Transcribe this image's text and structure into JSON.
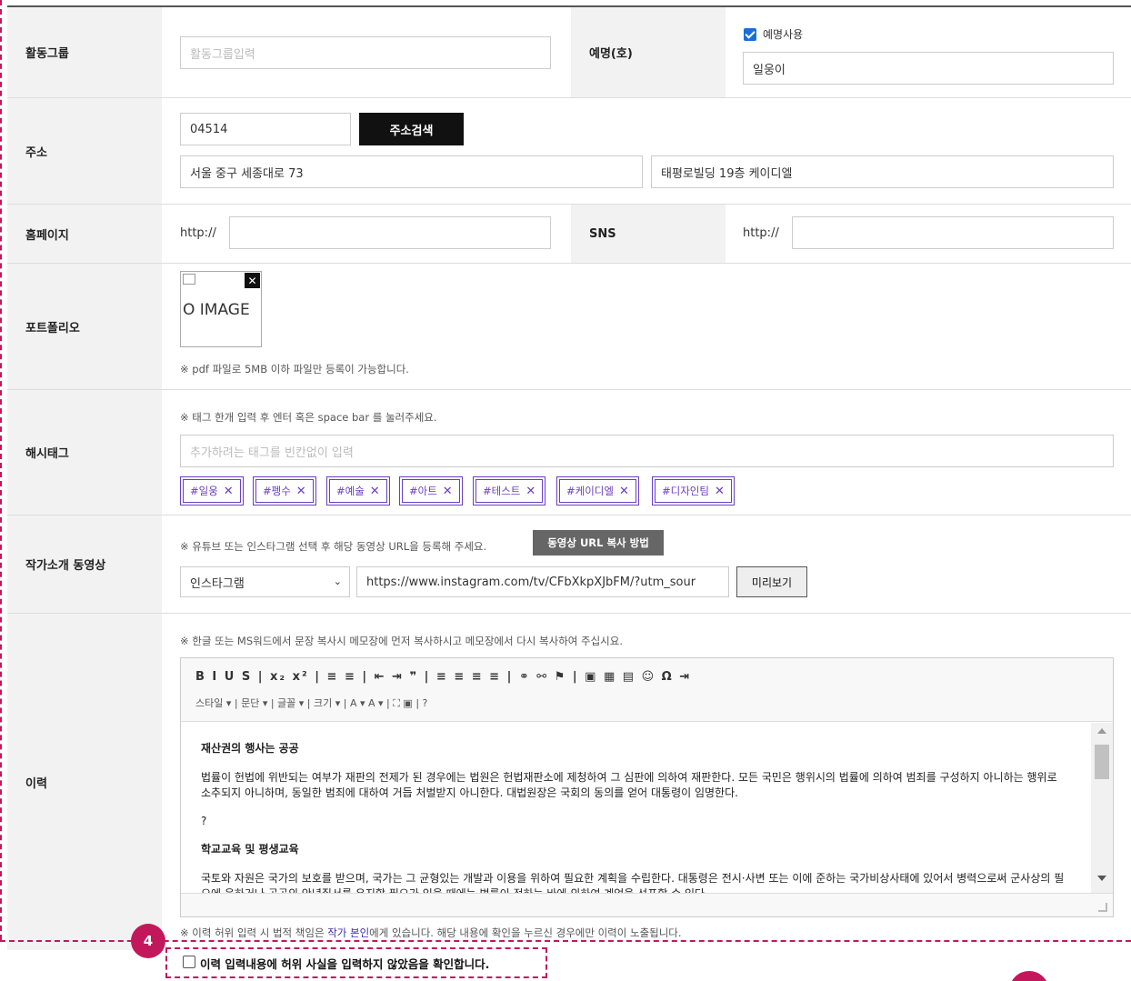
{
  "activity": {
    "label": "활동그룹",
    "placeholder": "활동그룹입력"
  },
  "pseudonym": {
    "label": "예명(호)",
    "checkbox_label": "예명사용",
    "checked": true,
    "value": "일웅이"
  },
  "address": {
    "label": "주소",
    "zipcode": "04514",
    "search_button": "주소검색",
    "address1": "서울 중구 세종대로 73",
    "address2": "태평로빌딩 19층 케이디엘"
  },
  "homepage": {
    "label": "홈페이지",
    "prefix": "http://",
    "value": ""
  },
  "sns": {
    "label": "SNS",
    "prefix": "http://",
    "value": ""
  },
  "portfolio": {
    "label": "포트폴리오",
    "image_alt": "O IMAGE",
    "note": "※ pdf 파일로 5MB 이하 파일만 등록이 가능합니다."
  },
  "hashtag": {
    "label": "해시태그",
    "note": "※ 태그 한개 입력 후 엔터 혹은 space bar 를 눌러주세요.",
    "placeholder": "추가하려는 태그를 빈칸없이 입력",
    "tags": [
      "#일웅",
      "#펭수",
      "#예술",
      "#아트",
      "#테스트",
      "#케이디엘",
      "#디자인팀"
    ]
  },
  "video": {
    "label": "작가소개 동영상",
    "note": "※ 유튜브 또는 인스타그램 선택 후 해당 동영상 URL을 등록해 주세요.",
    "help_button": "동영상 URL 복사 방법",
    "platform": "인스타그램",
    "url": "https://www.instagram.com/tv/CFbXkpXJbFM/?utm_sour",
    "preview_button": "미리보기"
  },
  "career": {
    "label": "이력",
    "note": "※ 한글 또는 MS워드에서 문장 복사시 메모장에 먼저 복사하시고 메모장에서 다시 복사하여 주십시요.",
    "toolbar_row1": "B I U S | x₂ x² | ≡ ≡ | ⇤ ⇥ ❞ | ≡ ≡ ≡ ≡ | ⚭ ⚯ ⚑ | ▣ ▦ ▤ ☺ Ω ⇥",
    "toolbar_row2": "스타일      ▾ | 문단        ▾ | 글꼴        ▾ | 크기        ▾ | A ▾  A ▾ | ⛶  ▣ | ?",
    "heading1": "재산권의 행사는 공공",
    "para1": "법률이 헌법에 위반되는 여부가 재판의 전제가 된 경우에는 법원은 헌법재판소에 제청하여 그 심판에 의하여 재판한다. 모든 국민은 행위시의 법률에 의하여 범죄를 구성하지 아니하는 행위로 소추되지 아니하며, 동일한 범죄에 대하여 거듭 처벌받지 아니한다. 대법원장은 국회의 동의를 얻어 대통령이 임명한다.",
    "question": "?",
    "heading2": "학교교육 및 평생교육",
    "para2": "국토와 자원은 국가의 보호를 받으며, 국가는 그 균형있는 개발과 이용을 위하여 필요한 계획을 수립한다. 대통령은 전시·사변 또는 이에 준하는 국가비상사태에 있어서 병력으로써 군사상의 필요에 응하거나 공공의 안녕질서를 유지할 필요가 있을 때에는 법률이 정하는 바에 의하여 계엄을 선포할 수 있다.",
    "warning_prefix": "※ 이력 허위 입력 시 법적 책임은 ",
    "warning_highlight": "작가 본인",
    "warning_suffix": "에게 있습니다. 해당 내용에 확인을 누르신 경우에만 이력이 노출됩니다.",
    "confirm": "이력 입력내용에 허위 사실을 입력하지 않았음을 확인합니다.",
    "step_badge": "4"
  },
  "colors": {
    "accent": "#c2185b",
    "tag": "#6b3ec2",
    "checkbox": "#1a6fd6"
  }
}
